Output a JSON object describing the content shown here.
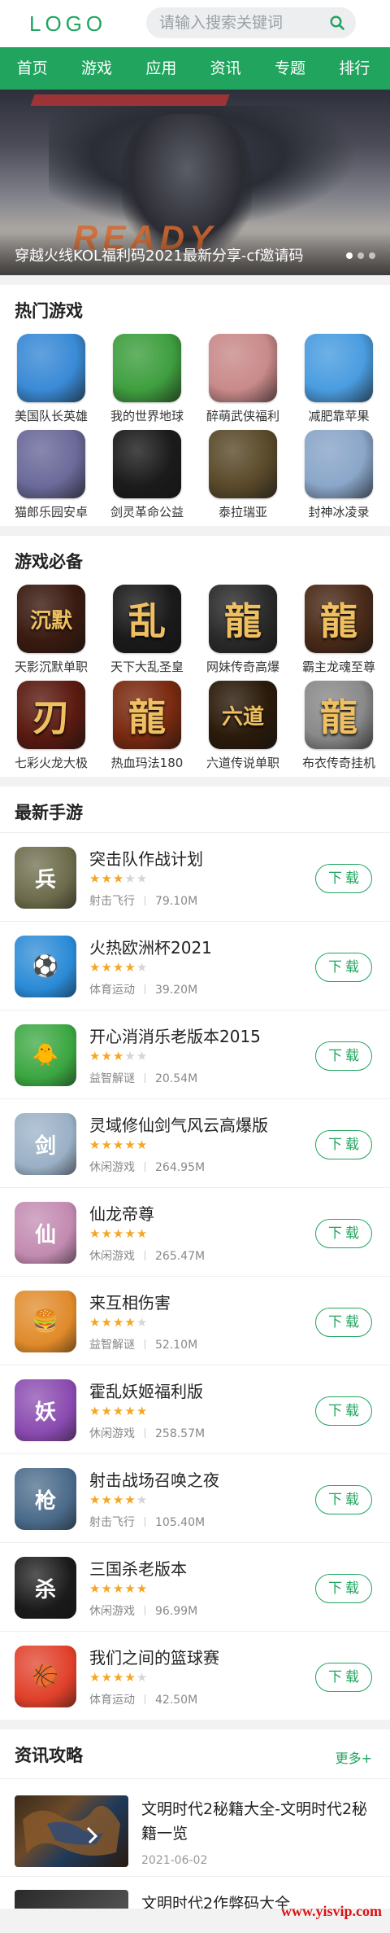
{
  "header": {
    "logo": "LOGO",
    "search_placeholder": "请输入搜索关键词"
  },
  "nav": [
    "首页",
    "游戏",
    "应用",
    "资讯",
    "专题",
    "排行"
  ],
  "banner": {
    "title": "穿越火线KOL福利码2021最新分享-cf邀请码",
    "art_text": "READY",
    "dots": 3,
    "active_dot": 0
  },
  "hot_games": {
    "title": "热门游戏",
    "items": [
      {
        "label": "美国队长英雄",
        "icon": "hero-icon",
        "color": "#3a8ad6"
      },
      {
        "label": "我的世界地球",
        "icon": "minecraft-earth-icon",
        "color": "#3f9f3f"
      },
      {
        "label": "醉萌武侠福利",
        "icon": "wuxia-girl-icon",
        "color": "#c98a8a"
      },
      {
        "label": "减肥靠苹果",
        "icon": "runner-icon",
        "color": "#4a9de0"
      },
      {
        "label": "猫郎乐园安卓",
        "icon": "cat-boys-icon",
        "color": "#6b6a9a"
      },
      {
        "label": "剑灵革命公益",
        "icon": "blade-soul-icon",
        "color": "#1b1b1b"
      },
      {
        "label": "泰拉瑞亚",
        "icon": "terraria-icon",
        "color": "#5a4a2a"
      },
      {
        "label": "封神冰凌录",
        "icon": "ice-princess-icon",
        "color": "#8aa6c9"
      }
    ]
  },
  "must_play": {
    "title": "游戏必备",
    "items": [
      {
        "label": "天影沉默单职",
        "icon": "silence-icon",
        "color": "#3a1a10",
        "glyph": "沉默"
      },
      {
        "label": "天下大乱圣皇",
        "icon": "chaos-icon",
        "color": "#1a1a1a",
        "glyph": "乱"
      },
      {
        "label": "网妹传奇高爆",
        "icon": "dragon-black-icon",
        "color": "#2a2a2a",
        "glyph": "龍"
      },
      {
        "label": "霸主龙魂至尊",
        "icon": "dragon-gold-icon",
        "color": "#4a2a18",
        "glyph": "龍"
      },
      {
        "label": "七彩火龙大极",
        "icon": "fire-dragon-icon",
        "color": "#5a1a10",
        "glyph": "刃"
      },
      {
        "label": "热血玛法180",
        "icon": "dragon-fire-icon",
        "color": "#7a2a10",
        "glyph": "龍"
      },
      {
        "label": "六道传说单职",
        "icon": "six-paths-icon",
        "color": "#2a1a0a",
        "glyph": "六道"
      },
      {
        "label": "布衣传奇挂机",
        "icon": "dragon-grey-icon",
        "color": "#8a8a8a",
        "glyph": "龍"
      }
    ]
  },
  "new_games": {
    "title": "最新手游",
    "download_label": "下载",
    "items": [
      {
        "title": "突击队作战计划",
        "stars": 3,
        "category": "射击飞行",
        "size": "79.10M",
        "icon": "soldier-icon",
        "color": "#6b6a4a",
        "glyph": "兵"
      },
      {
        "title": "火热欧洲杯2021",
        "stars": 4,
        "category": "体育运动",
        "size": "39.20M",
        "icon": "soccer-icon",
        "color": "#2a8ad6",
        "glyph": "⚽"
      },
      {
        "title": "开心消消乐老版本2015",
        "stars": 3,
        "category": "益智解谜",
        "size": "20.54M",
        "icon": "chick-icon",
        "color": "#3aa640",
        "glyph": "🐥"
      },
      {
        "title": "灵域修仙剑气风云高爆版",
        "stars": 5,
        "category": "休闲游戏",
        "size": "264.95M",
        "icon": "sword-spirit-icon",
        "color": "#9ab0c6",
        "glyph": "剑"
      },
      {
        "title": "仙龙帝尊",
        "stars": 5,
        "category": "休闲游戏",
        "size": "265.47M",
        "icon": "fairy-girl-icon",
        "color": "#c28ab0",
        "glyph": "仙"
      },
      {
        "title": "来互相伤害",
        "stars": 4,
        "category": "益智解谜",
        "size": "52.10M",
        "icon": "burger-icon",
        "color": "#e08a2a",
        "glyph": "🍔"
      },
      {
        "title": "霍乱妖姬福利版",
        "stars": 5,
        "category": "休闲游戏",
        "size": "258.57M",
        "icon": "demon-girl-icon",
        "color": "#8a4ab0",
        "glyph": "妖"
      },
      {
        "title": "射击战场召唤之夜",
        "stars": 4,
        "category": "射击飞行",
        "size": "105.40M",
        "icon": "battlefield-icon",
        "color": "#4a6a8a",
        "glyph": "枪"
      },
      {
        "title": "三国杀老版本",
        "stars": 5,
        "category": "休闲游戏",
        "size": "96.99M",
        "icon": "sanguosha-icon",
        "color": "#1a1a1a",
        "glyph": "杀"
      },
      {
        "title": "我们之间的篮球赛",
        "stars": 4,
        "category": "体育运动",
        "size": "42.50M",
        "icon": "basketball-icon",
        "color": "#e0402a",
        "glyph": "🏀"
      }
    ]
  },
  "news": {
    "title": "资讯攻略",
    "more_label": "更多+",
    "items": [
      {
        "title": "文明时代2秘籍大全-文明时代2秘籍一览",
        "date": "2021-06-02"
      },
      {
        "title": "文明时代2作弊码大全",
        "date": ""
      }
    ]
  },
  "watermark": "www.yisvip.com"
}
